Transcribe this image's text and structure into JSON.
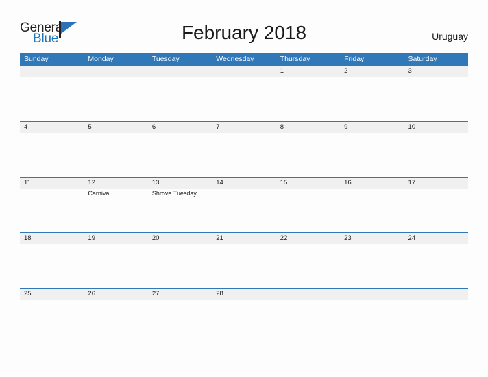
{
  "logo": {
    "word_one": "General",
    "word_two": "Blue",
    "flag_icon": "flag-icon",
    "accent_color": "#1b75bb"
  },
  "header": {
    "title": "February 2018",
    "country": "Uruguay"
  },
  "theme": {
    "header_blue": "#3178b9",
    "band_gray": "#f0f0f0",
    "page_background": "#fdfdfd",
    "text_color": "#1a1a1a"
  },
  "calendar": {
    "weekdays": [
      "Sunday",
      "Monday",
      "Tuesday",
      "Wednesday",
      "Thursday",
      "Friday",
      "Saturday"
    ],
    "weeks": [
      [
        {
          "num": "",
          "events": []
        },
        {
          "num": "",
          "events": []
        },
        {
          "num": "",
          "events": []
        },
        {
          "num": "",
          "events": []
        },
        {
          "num": "1",
          "events": []
        },
        {
          "num": "2",
          "events": []
        },
        {
          "num": "3",
          "events": []
        }
      ],
      [
        {
          "num": "4",
          "events": []
        },
        {
          "num": "5",
          "events": []
        },
        {
          "num": "6",
          "events": []
        },
        {
          "num": "7",
          "events": []
        },
        {
          "num": "8",
          "events": []
        },
        {
          "num": "9",
          "events": []
        },
        {
          "num": "10",
          "events": []
        }
      ],
      [
        {
          "num": "11",
          "events": []
        },
        {
          "num": "12",
          "events": [
            "Carnival"
          ]
        },
        {
          "num": "13",
          "events": [
            "Shrove Tuesday"
          ]
        },
        {
          "num": "14",
          "events": []
        },
        {
          "num": "15",
          "events": []
        },
        {
          "num": "16",
          "events": []
        },
        {
          "num": "17",
          "events": []
        }
      ],
      [
        {
          "num": "18",
          "events": []
        },
        {
          "num": "19",
          "events": []
        },
        {
          "num": "20",
          "events": []
        },
        {
          "num": "21",
          "events": []
        },
        {
          "num": "22",
          "events": []
        },
        {
          "num": "23",
          "events": []
        },
        {
          "num": "24",
          "events": []
        }
      ],
      [
        {
          "num": "25",
          "events": []
        },
        {
          "num": "26",
          "events": []
        },
        {
          "num": "27",
          "events": []
        },
        {
          "num": "28",
          "events": []
        },
        {
          "num": "",
          "events": []
        },
        {
          "num": "",
          "events": []
        },
        {
          "num": "",
          "events": []
        }
      ]
    ]
  }
}
